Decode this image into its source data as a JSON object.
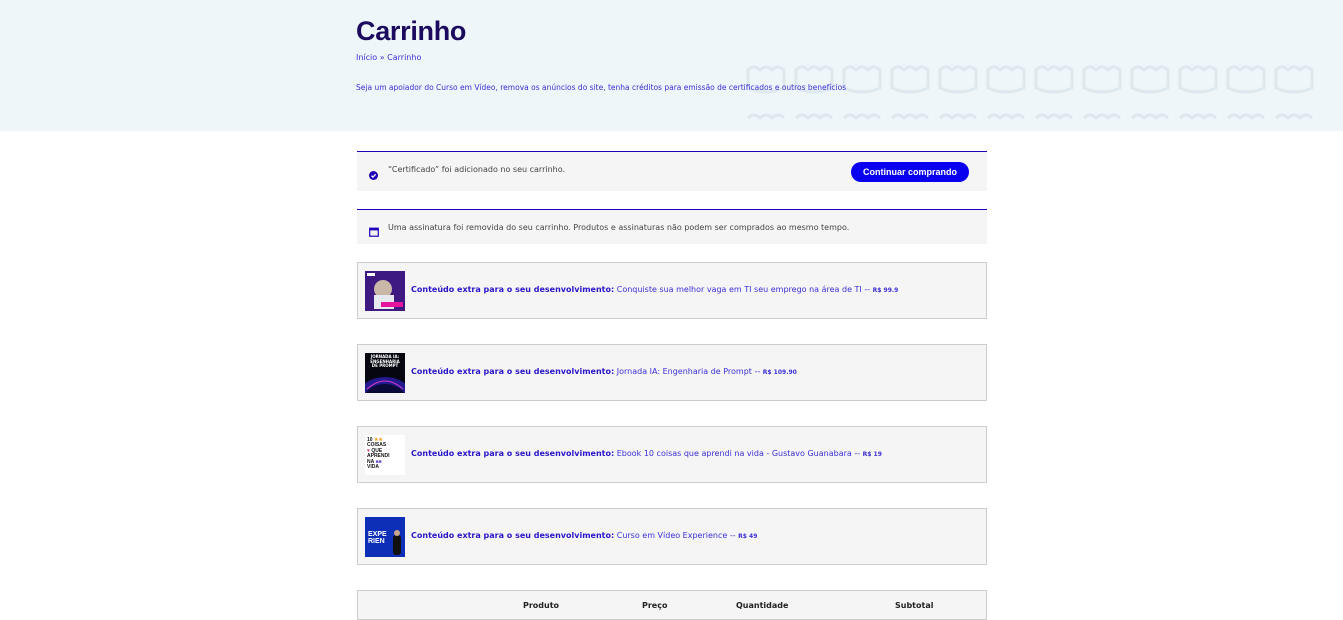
{
  "page": {
    "title": "Carrinho",
    "breadcrumb": {
      "home": "Início",
      "separator": " » ",
      "current": "Carrinho"
    },
    "promo": "Seja um apoiador do Curso em Vídeo, remova os anúncios do site, tenha créditos para emissão de certificados e outros benefícios"
  },
  "notices": {
    "added": {
      "icon": "check-circle-icon",
      "text": "“Certificado” foi adicionado no seu carrinho.",
      "button": "Continuar comprando"
    },
    "removed": {
      "icon": "calendar-icon",
      "text": "Uma assinatura foi removida do seu carrinho. Produtos e assinaturas não podem ser comprados ao mesmo tempo."
    }
  },
  "upsells": [
    {
      "prefix": "Conteúdo extra para o seu desenvolvimento:",
      "name": "Conquiste sua melhor vaga em TI seu emprego na área de TI",
      "sep": " -- ",
      "price": "R$ 99.9"
    },
    {
      "prefix": "Conteúdo extra para o seu desenvolvimento:",
      "name": "Jornada IA: Engenharia de Prompt",
      "sep": " -- ",
      "price": "R$ 109.90",
      "thumb_text": "JORNADA IA: ENGENHARIA DE PROMPT"
    },
    {
      "prefix": "Conteúdo extra para o seu desenvolvimento:",
      "name": "Ebook 10 coisas que aprendi na vida - Gustavo Guanabara",
      "sep": " -- ",
      "price": "R$ 19",
      "thumb_text": [
        "10",
        "COISAS",
        "QUE",
        "APRENDI",
        "NA",
        "VIDA"
      ]
    },
    {
      "prefix": "Conteúdo extra para o seu desenvolvimento:",
      "name": "Curso em Vídeo Experience",
      "sep": " -- ",
      "price": "R$ 49",
      "thumb_text": [
        "EXPE",
        "RIEN"
      ]
    }
  ],
  "table": {
    "headers": {
      "product": "Produto",
      "price": "Preço",
      "quantity": "Quantidade",
      "subtotal": "Subtotal"
    }
  },
  "colors": {
    "accent": "#0a00f0",
    "title": "#1b0a5e",
    "hero_bg": "#eef6fa",
    "link": "#3b2fd6"
  }
}
